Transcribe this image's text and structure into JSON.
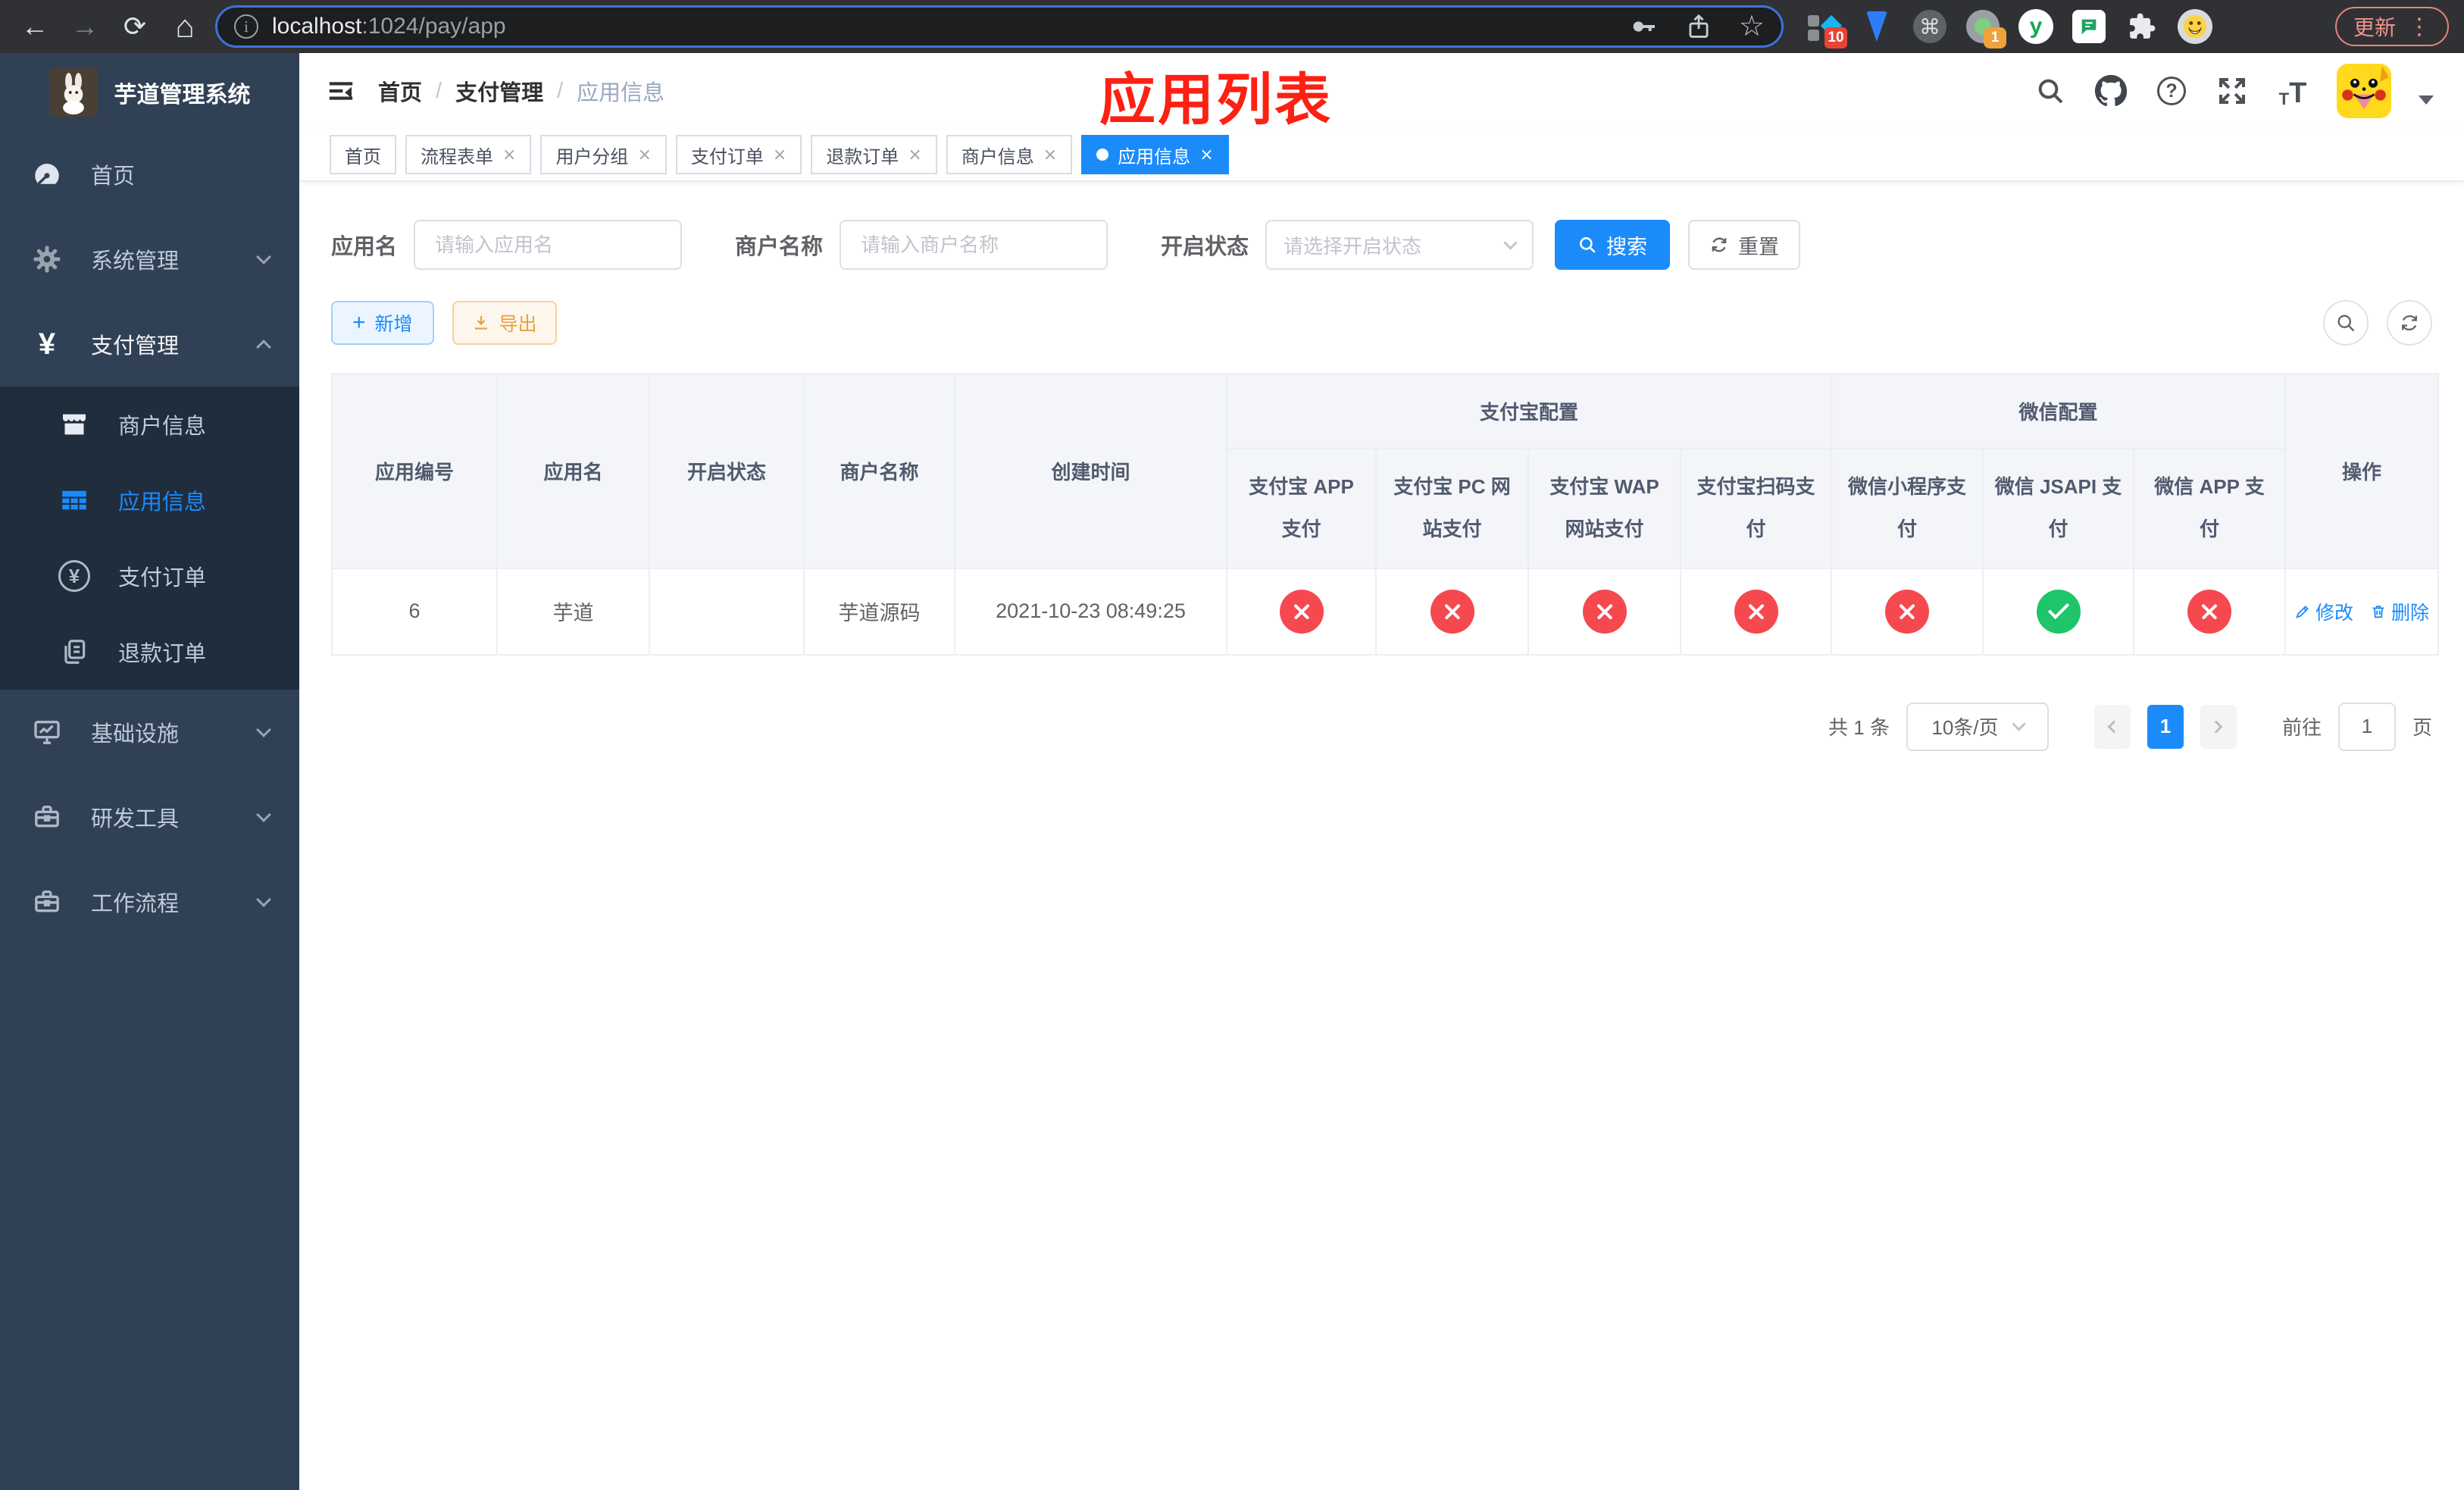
{
  "colors": {
    "primary": "#1b8bfa",
    "danger": "#f5494f",
    "success": "#1ec56a",
    "annotation_red": "#fd2013"
  },
  "browser": {
    "url_host": "localhost",
    "url_path": ":1024/pay/app",
    "update_label": "更新",
    "ext_badge_1": "10",
    "ext_badge_2": "1"
  },
  "sidebar": {
    "logo_title": "芋道管理系统",
    "items": [
      {
        "label": "首页"
      },
      {
        "label": "系统管理"
      },
      {
        "label": "支付管理"
      },
      {
        "label": "基础设施"
      },
      {
        "label": "研发工具"
      },
      {
        "label": "工作流程"
      }
    ],
    "payment_children": [
      {
        "label": "商户信息"
      },
      {
        "label": "应用信息"
      },
      {
        "label": "支付订单"
      },
      {
        "label": "退款订单"
      }
    ]
  },
  "navbar": {
    "breadcrumb": [
      "首页",
      "支付管理",
      "应用信息"
    ],
    "annotation": "应用列表"
  },
  "tags": [
    {
      "label": "首页"
    },
    {
      "label": "流程表单"
    },
    {
      "label": "用户分组"
    },
    {
      "label": "支付订单"
    },
    {
      "label": "退款订单"
    },
    {
      "label": "商户信息"
    },
    {
      "label": "应用信息"
    }
  ],
  "filters": {
    "app_name_label": "应用名",
    "app_name_placeholder": "请输入应用名",
    "merchant_label": "商户名称",
    "merchant_placeholder": "请输入商户名称",
    "status_label": "开启状态",
    "status_placeholder": "请选择开启状态",
    "search_label": "搜索",
    "reset_label": "重置"
  },
  "toolbar": {
    "add_label": "新增",
    "export_label": "导出"
  },
  "table": {
    "simple_columns": [
      "应用编号",
      "应用名",
      "开启状态",
      "商户名称",
      "创建时间"
    ],
    "group_headers": [
      "支付宝配置",
      "微信配置"
    ],
    "sub_columns": [
      "支付宝 APP 支付",
      "支付宝 PC 网站支付",
      "支付宝 WAP 网站支付",
      "支付宝扫码支付",
      "微信小程序支付",
      "微信 JSAPI 支付",
      "微信 APP 支付"
    ],
    "ops_column": "操作",
    "rows": [
      {
        "id": "6",
        "name": "芋道",
        "enabled": true,
        "merchant": "芋道源码",
        "created": "2021-10-23 08:49:25",
        "pay_status": [
          "no",
          "no",
          "no",
          "no",
          "no",
          "yes",
          "no"
        ],
        "edit_label": "修改",
        "delete_label": "删除"
      }
    ]
  },
  "pagination": {
    "total": "共 1 条",
    "page_size": "10条/页",
    "page": "1",
    "goto_label": "前往",
    "goto_value": "1",
    "page_unit": "页"
  }
}
